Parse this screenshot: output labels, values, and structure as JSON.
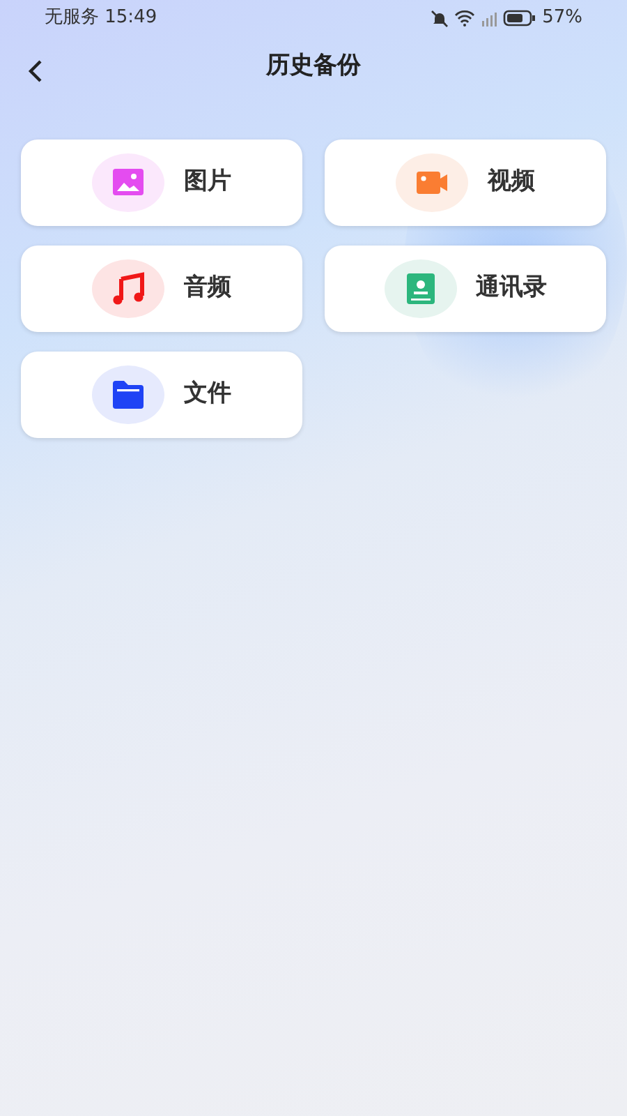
{
  "status_bar": {
    "carrier_time": "无服务 15:49",
    "battery": "57%"
  },
  "header": {
    "title": "历史备份"
  },
  "categories": [
    {
      "label": "图片",
      "kind": "image"
    },
    {
      "label": "视频",
      "kind": "video"
    },
    {
      "label": "音频",
      "kind": "music"
    },
    {
      "label": "通讯录",
      "kind": "contacts"
    },
    {
      "label": "文件",
      "kind": "folder"
    }
  ]
}
